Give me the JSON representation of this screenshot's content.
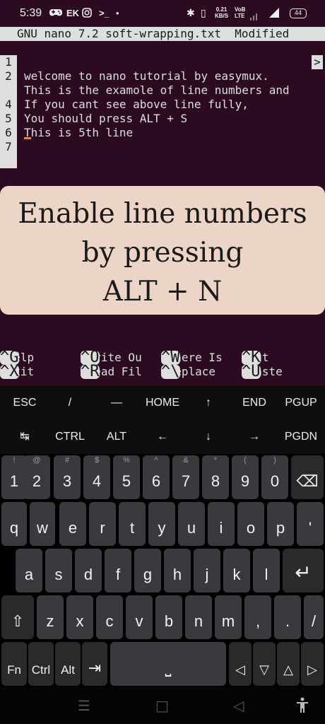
{
  "status_bar": {
    "time": "5:39",
    "left_icons": [
      "gamepad-icon",
      "ek-icon",
      "instagram-icon",
      "terminal-icon",
      "dot-icon"
    ],
    "ek": "EK",
    "prompt": ">_",
    "dot": "•",
    "bluetooth": "✱",
    "vibrate": "▯",
    "net_speed_value": "0.21",
    "net_speed_unit": "KB/S",
    "volte_top": "VoB",
    "volte_bottom": "LTE",
    "signal": "▮▮",
    "battery": "44"
  },
  "nano": {
    "title": "GNU nano 7.2 soft-wrapping.txt  Modified",
    "lines": [
      {
        "num": "1",
        "text": "welcome to nano tutorial by easymux."
      },
      {
        "num": "2",
        "text": "This is the examole of line numbers and"
      },
      {
        "num": "",
        "text": "If you cant see above line fully,"
      },
      {
        "num": "4",
        "text": "You should press ALT + S"
      },
      {
        "num": "5",
        "text": "This is 5th line"
      },
      {
        "num": "6",
        "text": ""
      },
      {
        "num": "7",
        "text": ""
      }
    ],
    "overflow_marker": ">",
    "shortcuts": [
      {
        "key": "^G",
        "label": " Help"
      },
      {
        "key": "^O",
        "label": " Write Ou"
      },
      {
        "key": "^W",
        "label": " Where Is"
      },
      {
        "key": "^K",
        "label": " Cut"
      },
      {
        "key": "^X",
        "label": " Exit"
      },
      {
        "key": "^R",
        "label": " Read Fil"
      },
      {
        "key": "^\\",
        "label": " Replace"
      },
      {
        "key": "^U",
        "label": " Paste"
      }
    ]
  },
  "caption": {
    "line1": "Enable line numbers",
    "line2": "by pressing",
    "line3": "ALT + N"
  },
  "extra_keys": {
    "row1": [
      "ESC",
      "/",
      "—",
      "HOME",
      "↑",
      "END",
      "PGUP"
    ],
    "row2": [
      "↹",
      "CTRL",
      "ALT",
      "←",
      "↓",
      "→",
      "PGDN"
    ]
  },
  "keyboard": {
    "row_numbers": [
      {
        "k": "1",
        "h": "!"
      },
      {
        "k": "2",
        "h": "@"
      },
      {
        "k": "3",
        "h": "#"
      },
      {
        "k": "4",
        "h": "$"
      },
      {
        "k": "5",
        "h": "%"
      },
      {
        "k": "6",
        "h": "^"
      },
      {
        "k": "7",
        "h": "&"
      },
      {
        "k": "8",
        "h": "*"
      },
      {
        "k": "9",
        "h": "("
      },
      {
        "k": "0",
        "h": ")"
      }
    ],
    "row_q": [
      "q",
      "w",
      "e",
      "r",
      "t",
      "y",
      "u",
      "i",
      "o",
      "p",
      "'"
    ],
    "row_a": [
      "a",
      "s",
      "d",
      "f",
      "g",
      "h",
      "j",
      "k",
      "l"
    ],
    "row_z": [
      "z",
      "x",
      "c",
      "v",
      "b",
      "n",
      "m",
      ",",
      ".",
      "/"
    ],
    "backspace": "⌫",
    "enter": "↵",
    "shift": "⇧",
    "fn": "Fn",
    "ctrl": "Ctrl",
    "alt": "Alt",
    "tab": "⇥",
    "space": "⎵",
    "arrows": [
      "◁",
      "▽",
      "△",
      "▷"
    ]
  },
  "nav_bar": {
    "menu": "☰",
    "home": "□",
    "back": "◁",
    "accessibility": "🚶"
  }
}
